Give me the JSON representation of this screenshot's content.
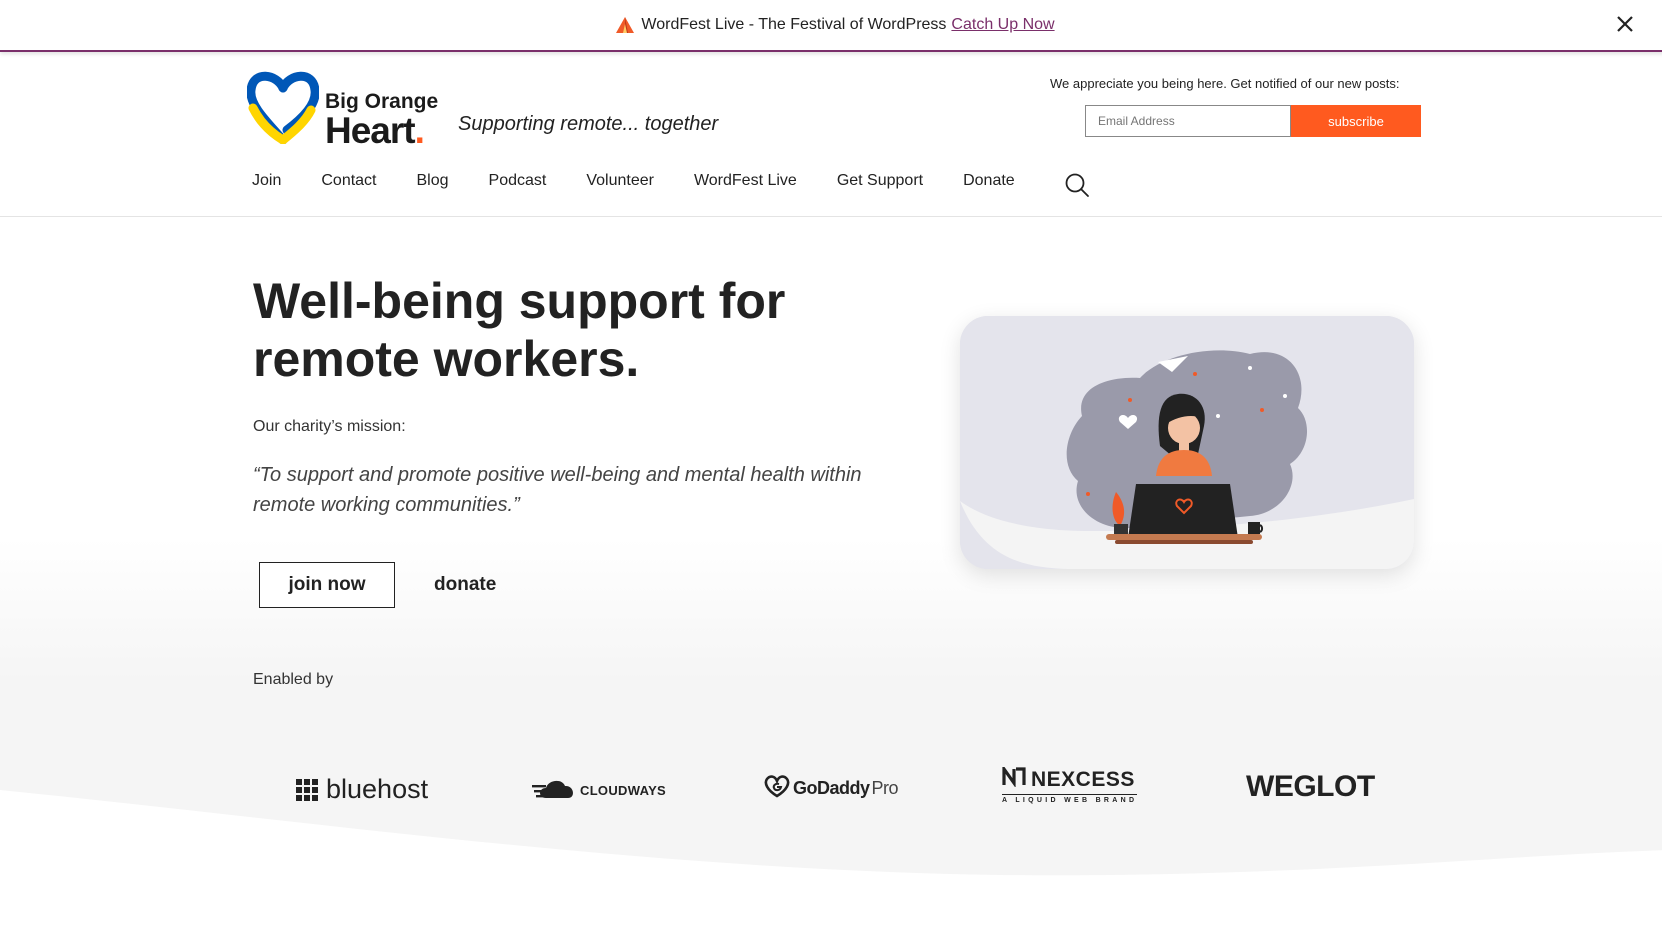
{
  "banner": {
    "text": "WordFest Live - The Festival of WordPress",
    "link": "Catch Up Now",
    "icon": "tent-icon",
    "close_icon": "close-icon"
  },
  "header": {
    "logo_line1": "Big Orange",
    "logo_line2": "Heart",
    "logo_dot": ".",
    "tagline": "Supporting remote... together",
    "notify_text": "We appreciate you being here. Get notified of our new posts:",
    "email_placeholder": "Email Address",
    "subscribe_label": "subscribe"
  },
  "nav": {
    "items": [
      "Join",
      "Contact",
      "Blog",
      "Podcast",
      "Volunteer",
      "WordFest Live",
      "Get Support",
      "Donate"
    ],
    "search_icon": "search-icon"
  },
  "hero": {
    "title": "Well-being support for remote workers.",
    "mission_label": "Our charity’s mission:",
    "mission_quote": "“To support and promote positive well-being and mental health within remote working communities.”",
    "join_label": "join now",
    "donate_label": "donate"
  },
  "sponsors": {
    "label": "Enabled by",
    "bluehost": "bluehost",
    "cloudways": "CLOUDWAYS",
    "godaddy": "GoDaddy",
    "godaddy_suffix": "Pro",
    "nexcess": "NEXCESS",
    "nexcess_sub": "A LIQUID WEB BRAND",
    "weglot": "WEGLOT"
  },
  "colors": {
    "accent": "#ff5a1f",
    "banner_link": "#7a2f6a",
    "logo_blue": "#0057b7",
    "logo_yellow": "#ffd500"
  }
}
